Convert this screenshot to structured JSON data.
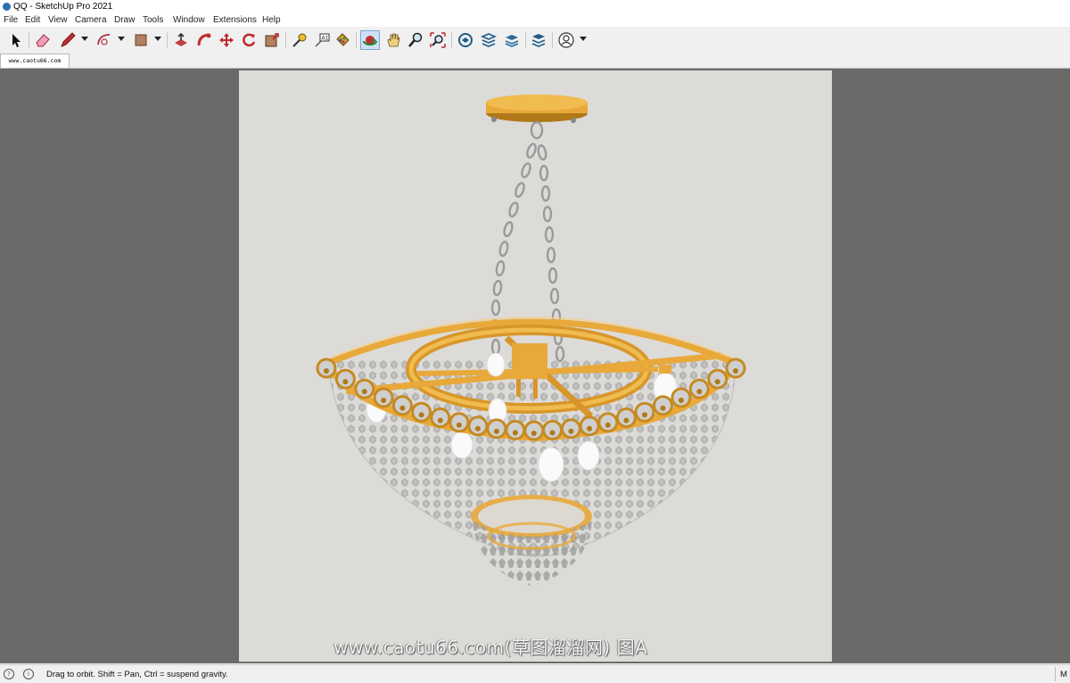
{
  "window": {
    "title": "QQ - SketchUp Pro 2021",
    "icon": "sketchup-app-icon"
  },
  "menu": {
    "items": [
      "File",
      "Edit",
      "View",
      "Camera",
      "Draw",
      "Tools",
      "Window",
      "Extensions",
      "Help"
    ]
  },
  "toolbar": {
    "tools": [
      {
        "name": "select-icon"
      },
      {
        "name": "eraser-icon"
      },
      {
        "name": "pencil-icon"
      },
      {
        "name": "arc-icon"
      },
      {
        "name": "rectangle-icon"
      },
      {
        "name": "push-pull-icon"
      },
      {
        "name": "follow-me-icon"
      },
      {
        "name": "move-icon"
      },
      {
        "name": "rotate-icon"
      },
      {
        "name": "scale-icon"
      },
      {
        "name": "tape-measure-icon"
      },
      {
        "name": "text-icon"
      },
      {
        "name": "paint-bucket-icon"
      },
      {
        "name": "orbit-icon",
        "active": true
      },
      {
        "name": "pan-icon"
      },
      {
        "name": "zoom-icon"
      },
      {
        "name": "zoom-extents-icon"
      },
      {
        "name": "3d-warehouse-icon"
      },
      {
        "name": "extension-warehouse-icon"
      },
      {
        "name": "layout-icon"
      },
      {
        "name": "extension-manager-icon"
      },
      {
        "name": "account-icon"
      }
    ]
  },
  "tab": {
    "label": "www.caotu66.com"
  },
  "watermark": {
    "text": "www.caotu66.com(草图溜溜网) 图A"
  },
  "status": {
    "message": "Drag to orbit. Shift = Pan, Ctrl = suspend gravity.",
    "measurements_label": "M"
  },
  "colors": {
    "viewport_bg": "#6b6a69",
    "canvas_bg": "#dddbd8",
    "gold": "#e8a93a",
    "gold_dark": "#b07818",
    "crystal": "#9a9a9a"
  }
}
